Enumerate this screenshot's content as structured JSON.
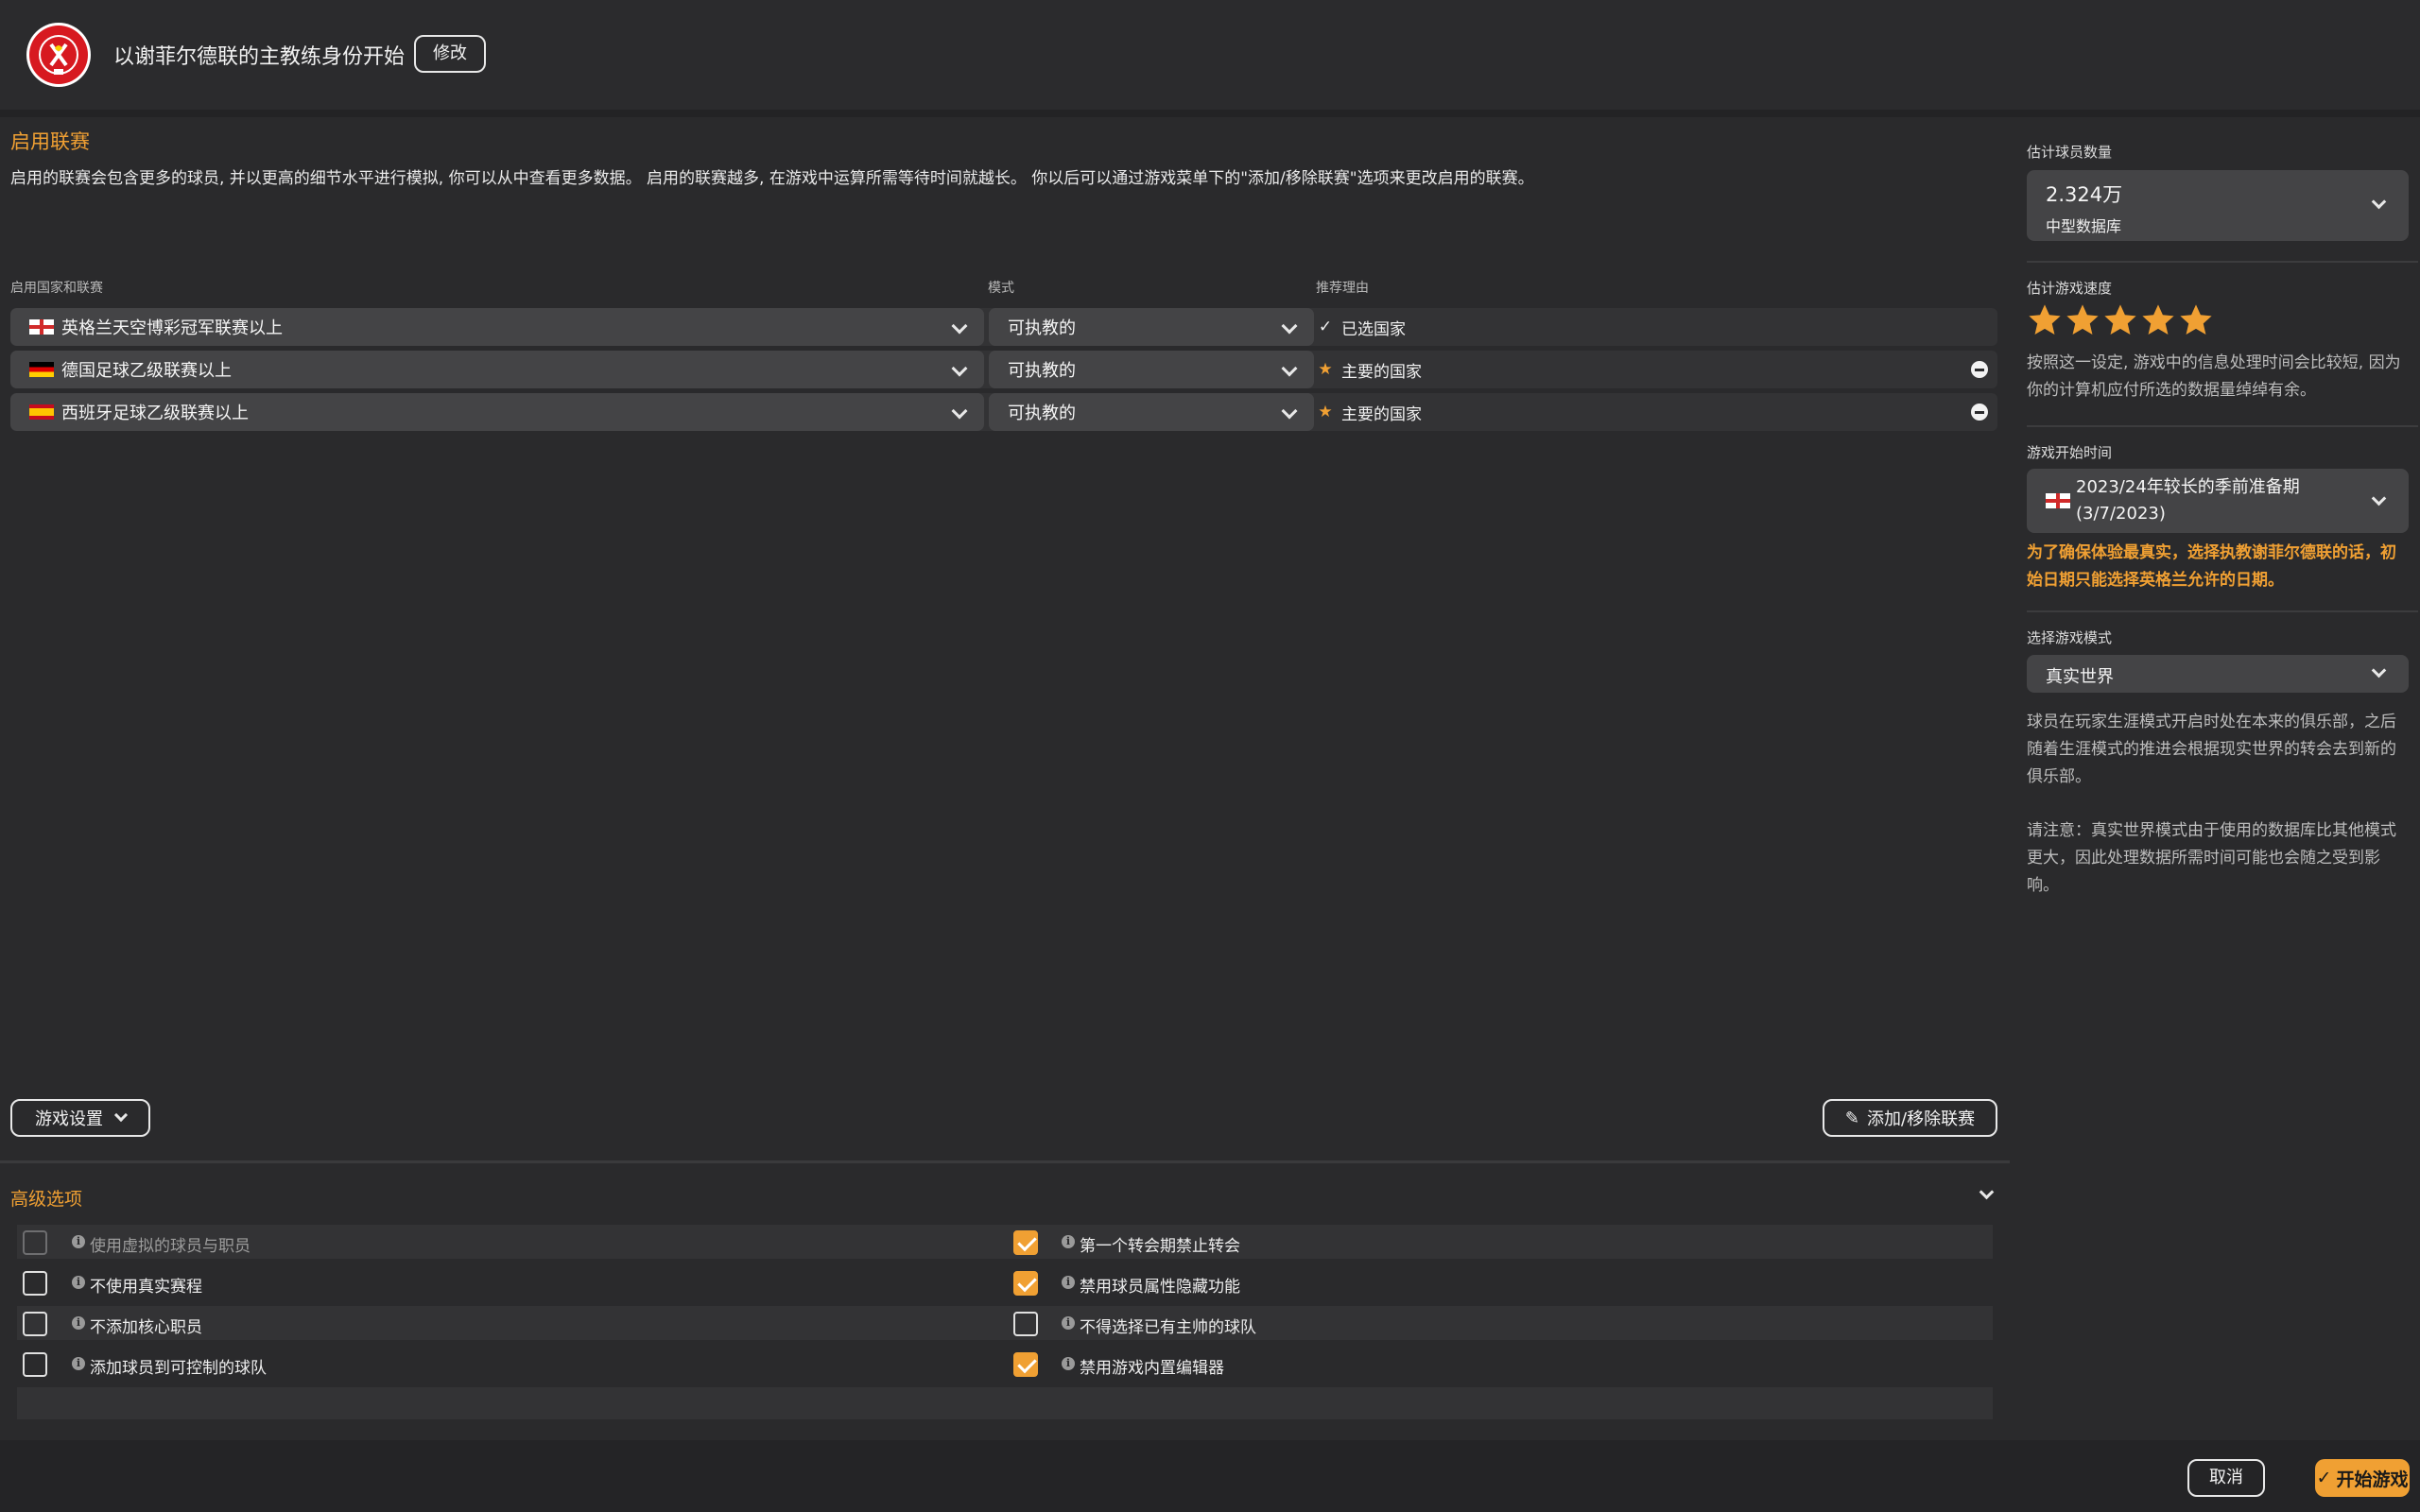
{
  "header": {
    "title": "以谢菲尔德联的主教练身份开始",
    "edit_label": "修改"
  },
  "leagues": {
    "section_title": "启用联赛",
    "description": "启用的联赛会包含更多的球员, 并以更高的细节水平进行模拟, 你可以从中查看更多数据。 启用的联赛越多, 在游戏中运算所需等待时间就越长。 你以后可以通过游戏菜单下的\"添加/移除联赛\"选项来更改启用的联赛。",
    "col_country": "启用国家和联赛",
    "col_mode": "模式",
    "col_reason": "推荐理由",
    "rows": [
      {
        "flag": "england",
        "league": "英格兰天空博彩冠军联赛以上",
        "mode": "可执教的",
        "reason_icon": "check-icon",
        "reason": "已选国家",
        "removable": false
      },
      {
        "flag": "germany",
        "league": "德国足球乙级联赛以上",
        "mode": "可执教的",
        "reason_icon": "star-icon",
        "reason": "主要的国家",
        "removable": true
      },
      {
        "flag": "spain",
        "league": "西班牙足球乙级联赛以上",
        "mode": "可执教的",
        "reason_icon": "star-icon",
        "reason": "主要的国家",
        "removable": true
      }
    ],
    "game_settings_label": "游戏设置",
    "add_remove_label": "添加/移除联赛"
  },
  "advanced": {
    "title": "高级选项",
    "options": [
      {
        "label": "使用虚拟的球员与职员",
        "checked": false,
        "disabled": true
      },
      {
        "label": "第一个转会期禁止转会",
        "checked": true,
        "disabled": false
      },
      {
        "label": "不使用真实赛程",
        "checked": false,
        "disabled": false
      },
      {
        "label": "禁用球员属性隐藏功能",
        "checked": true,
        "disabled": false
      },
      {
        "label": "不添加核心职员",
        "checked": false,
        "disabled": false
      },
      {
        "label": "不得选择已有主帅的球队",
        "checked": false,
        "disabled": false
      },
      {
        "label": "添加球员到可控制的球队",
        "checked": false,
        "disabled": false
      },
      {
        "label": "禁用游戏内置编辑器",
        "checked": true,
        "disabled": false
      }
    ]
  },
  "sidebar": {
    "player_count_label": "估计球员数量",
    "player_count_value": "2.324万",
    "player_count_db": "中型数据库",
    "speed_label": "估计游戏速度",
    "speed_stars": 5,
    "speed_note": "按照这一设定, 游戏中的信息处理时间会比较短, 因为你的计算机应付所选的数据量绰绰有余。",
    "start_time_label": "游戏开始时间",
    "start_time_value": "2023/24年较长的季前准备期 (3/7/2023)",
    "start_time_warning": "为了确保体验最真实，选择执教谢菲尔德联的话，初始日期只能选择英格兰允许的日期。",
    "mode_label": "选择游戏模式",
    "mode_value": "真实世界",
    "mode_desc": "球员在玩家生涯模式开启时处在本来的俱乐部，之后随着生涯模式的推进会根据现实世界的转会去到新的俱乐部。",
    "mode_note": "请注意：真实世界模式由于使用的数据库比其他模式更大，因此处理数据所需时间可能也会随之受到影响。"
  },
  "footer": {
    "cancel_label": "取消",
    "start_label": "开始游戏"
  },
  "colors": {
    "accent": "#f0a033",
    "background": "#2a2a2c",
    "control": "#444446"
  }
}
